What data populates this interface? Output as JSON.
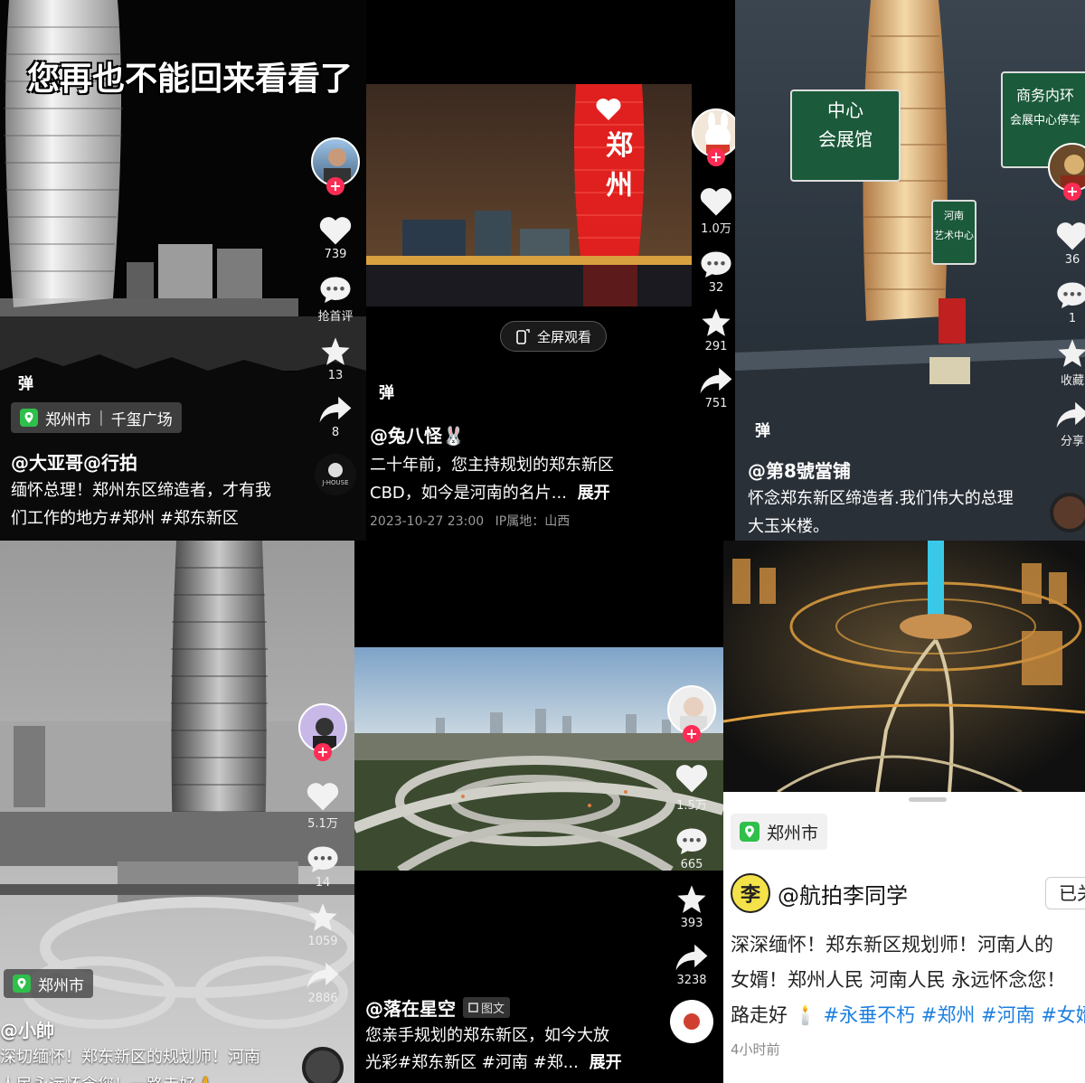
{
  "p1": {
    "overlay": "您再也不能回来看看了",
    "likes": "739",
    "comments": "抢首评",
    "stars": "13",
    "shares": "8",
    "danmu": "弹",
    "loc_city": "郑州市",
    "loc_place": "千玺广场",
    "handle": "@大亚哥@行拍",
    "desc": "缅怀总理！郑州东区缔造者，才有我们工作的地方#郑州 #郑东新区",
    "music_label": "J-HOUSE"
  },
  "p2": {
    "tower_text": "郑州",
    "likes": "1.0万",
    "comments": "32",
    "stars": "291",
    "shares": "751",
    "fullscreen": "全屏观看",
    "danmu": "弹",
    "handle": "@兔八怪🐰",
    "desc_line1": "二十年前，您主持规划的郑东新区",
    "desc_line2": "CBD，如今是河南的名片...",
    "expand": "展开",
    "time": "2023-10-27 23:00",
    "ip": "IP属地：山西"
  },
  "p3": {
    "sign1_line1": "中心",
    "sign1_line2": "会展馆",
    "sign2_line1": "商务内环",
    "sign2_line2": "会展中心停车",
    "sign3_line1": "河南",
    "sign3_line2": "艺术中心",
    "likes": "36",
    "comments": "1",
    "stars": "收藏",
    "shares": "分享",
    "danmu": "弹",
    "handle": "@第8號當铺",
    "desc": "怀念郑东新区缔造者.我们伟大的总理大玉米楼。"
  },
  "p4": {
    "likes": "5.1万",
    "comments": "14",
    "stars": "1059",
    "shares": "2886",
    "loc_city": "郑州市",
    "handle": "@小帥",
    "desc": "深切缅怀！郑东新区的规划师！河南人民永远怀念您！一路走好🙏"
  },
  "p5": {
    "likes": "1.5万",
    "comments": "665",
    "stars": "393",
    "shares": "3238",
    "handle": "@落在星空",
    "badge": "图文",
    "desc_line1": "您亲手规划的郑东新区，如今大放",
    "desc_line2": "光彩#郑东新区 #河南 #郑...",
    "expand": "展开"
  },
  "p6": {
    "loc_city": "郑州市",
    "avatar_char": "李",
    "handle": "@航拍李同学",
    "follow": "已关",
    "desc_line1": "深深缅怀！郑东新区规划师！河南人的",
    "desc_line2": "女婿！郑州人民 河南人民 永远怀念您！",
    "desc_line3_plain": "路走好 🕯️",
    "desc_line3_tags": "#永垂不朽 #郑州 #河南 #女婿",
    "time": "4小时前"
  },
  "colors": {
    "accent_red": "#fe2c55",
    "tag_blue": "#1c7fe0",
    "location_green": "#2fbf4b"
  }
}
